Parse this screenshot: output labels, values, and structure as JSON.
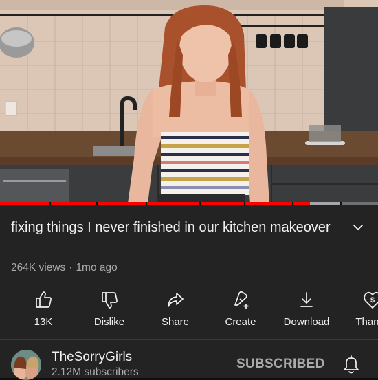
{
  "video": {
    "title": "fixing things I never finished in our kitchen makeover",
    "views": "264K views",
    "age": "1mo ago",
    "progress_played_fraction": 0.82,
    "progress_buffered_fraction": 0.9
  },
  "actions": [
    {
      "label": "13K",
      "icon": "thumbs-up-icon"
    },
    {
      "label": "Dislike",
      "icon": "thumbs-down-icon"
    },
    {
      "label": "Share",
      "icon": "share-icon"
    },
    {
      "label": "Create",
      "icon": "create-sparkle-icon"
    },
    {
      "label": "Download",
      "icon": "download-icon"
    },
    {
      "label": "Thanks",
      "icon": "thanks-icon"
    }
  ],
  "channel": {
    "name": "TheSorryGirls",
    "subscribers": "2.12M subscribers",
    "subscribe_state": "SUBSCRIBED"
  },
  "colors": {
    "progress": "#ff0000",
    "background": "#232323",
    "text": "#f1f1f1",
    "muted": "#aaaaaa"
  }
}
